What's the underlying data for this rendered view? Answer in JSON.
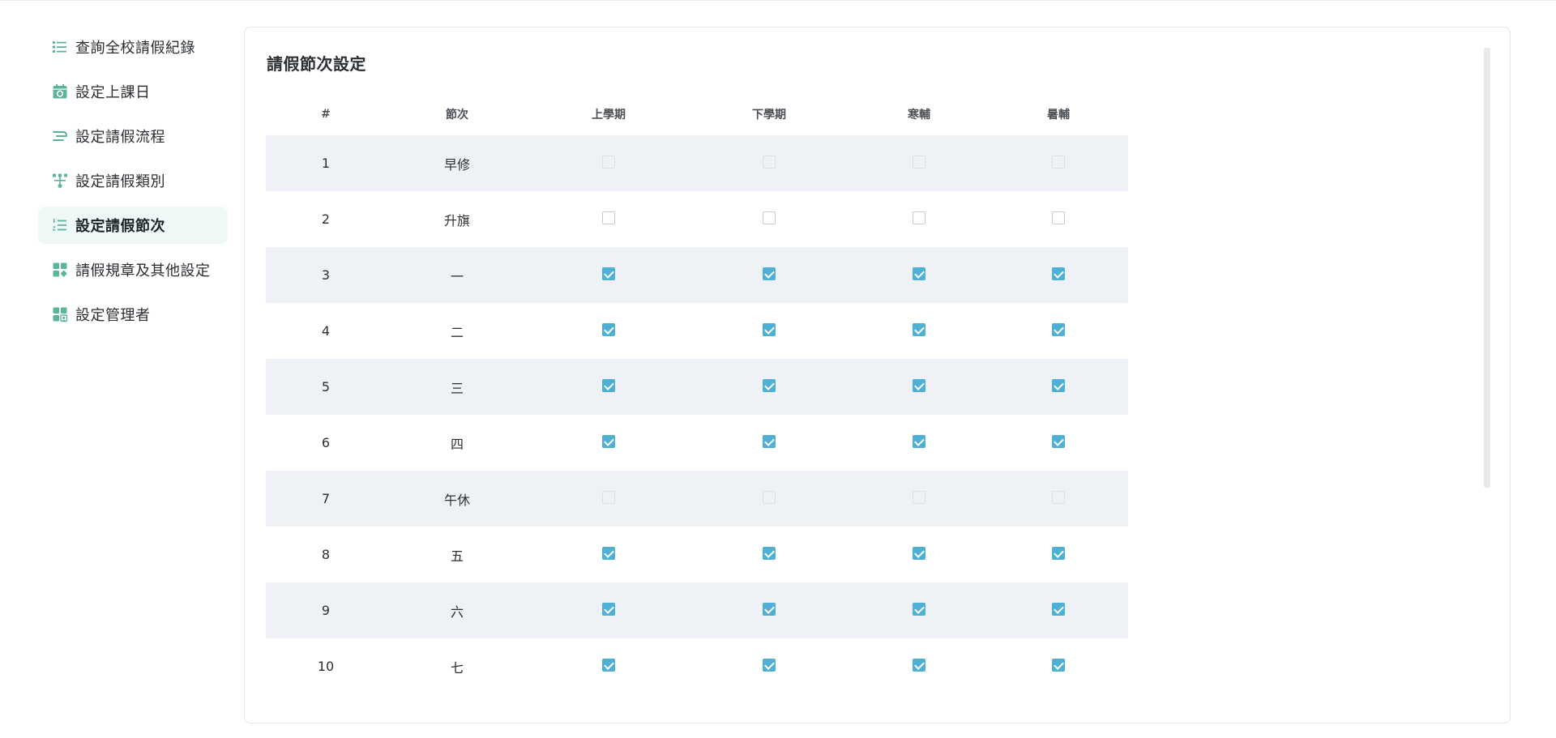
{
  "colors": {
    "accent": "#5bb59a",
    "checkbox_checked": "#4db0d4",
    "row_stripe": "#eef1f5",
    "active_nav_bg": "#eef8f6"
  },
  "sidebar": {
    "items": [
      {
        "label": "查詢全校請假紀錄",
        "icon": "list-icon",
        "active": false
      },
      {
        "label": "設定上課日",
        "icon": "calendar-icon",
        "active": false
      },
      {
        "label": "設定請假流程",
        "icon": "flow-icon",
        "active": false
      },
      {
        "label": "設定請假類別",
        "icon": "category-tree-icon",
        "active": false
      },
      {
        "label": "設定請假節次",
        "icon": "ordered-list-icon",
        "active": true
      },
      {
        "label": "請假規章及其他設定",
        "icon": "widgets-icon",
        "active": false
      },
      {
        "label": "設定管理者",
        "icon": "admin-grid-icon",
        "active": false
      }
    ]
  },
  "main": {
    "title": "請假節次設定",
    "table": {
      "headers": [
        "#",
        "節次",
        "上學期",
        "下學期",
        "寒輔",
        "暑輔"
      ],
      "rows": [
        {
          "num": "1",
          "period": "早修",
          "state": "disabled"
        },
        {
          "num": "2",
          "period": "升旗",
          "state": "unchecked"
        },
        {
          "num": "3",
          "period": "一",
          "state": "checked"
        },
        {
          "num": "4",
          "period": "二",
          "state": "checked"
        },
        {
          "num": "5",
          "period": "三",
          "state": "checked"
        },
        {
          "num": "6",
          "period": "四",
          "state": "checked"
        },
        {
          "num": "7",
          "period": "午休",
          "state": "disabled"
        },
        {
          "num": "8",
          "period": "五",
          "state": "checked"
        },
        {
          "num": "9",
          "period": "六",
          "state": "checked"
        },
        {
          "num": "10",
          "period": "七",
          "state": "checked"
        }
      ]
    }
  }
}
